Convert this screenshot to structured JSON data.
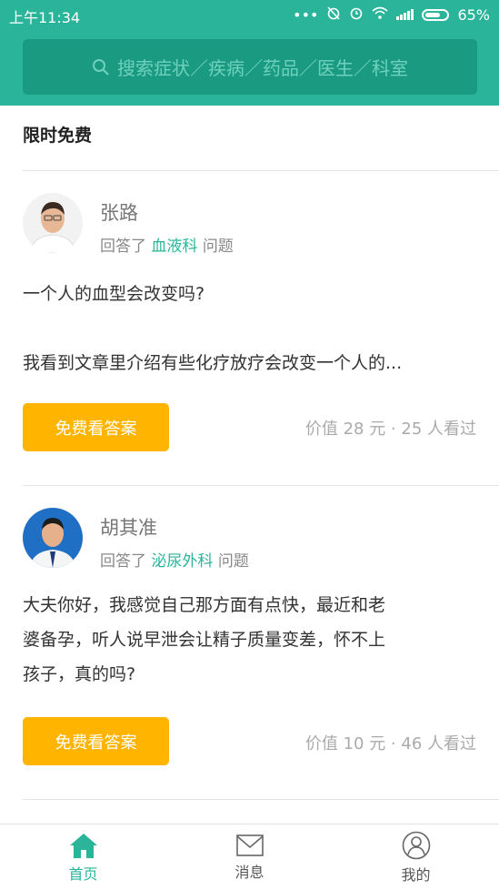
{
  "status_bar": {
    "time": "上午11:34",
    "battery": "65%",
    "icons": [
      "more-dots-icon",
      "alarm-off-icon",
      "alarm-icon",
      "wifi-icon",
      "signal-icon",
      "battery-icon"
    ]
  },
  "search": {
    "placeholder": "搜索症状／疾病／药品／医生／科室",
    "icon": "search-icon"
  },
  "section": {
    "title": "限时免费"
  },
  "cards": [
    {
      "doctor": "张路",
      "answered_prefix": "回答了",
      "department": "血液科",
      "answered_suffix": "问题",
      "question_lines": [
        "一个人的血型会改变吗?",
        "",
        "我看到文章里介绍有些化疗放疗会改变一个人的..."
      ],
      "button": "免费看答案",
      "meta": "价值 28 元 · 25 人看过"
    },
    {
      "doctor": "胡其准",
      "answered_prefix": "回答了",
      "department": "泌尿外科",
      "answered_suffix": "问题",
      "question_lines": [
        "大夫你好，我感觉自己那方面有点快，最近和老",
        "婆备孕，听人说早泄会让精子质量变差，怀不上",
        "孩子，真的吗?"
      ],
      "button": "免费看答案",
      "meta": "价值 10 元 · 46 人看过"
    }
  ],
  "tabs": [
    {
      "label": "首页",
      "icon": "home-icon",
      "active": true
    },
    {
      "label": "消息",
      "icon": "mail-icon",
      "active": false
    },
    {
      "label": "我的",
      "icon": "user-icon",
      "active": false
    }
  ],
  "colors": {
    "accent": "#2ab59a",
    "search_bg": "#1a9a80",
    "button": "#ffb400"
  }
}
